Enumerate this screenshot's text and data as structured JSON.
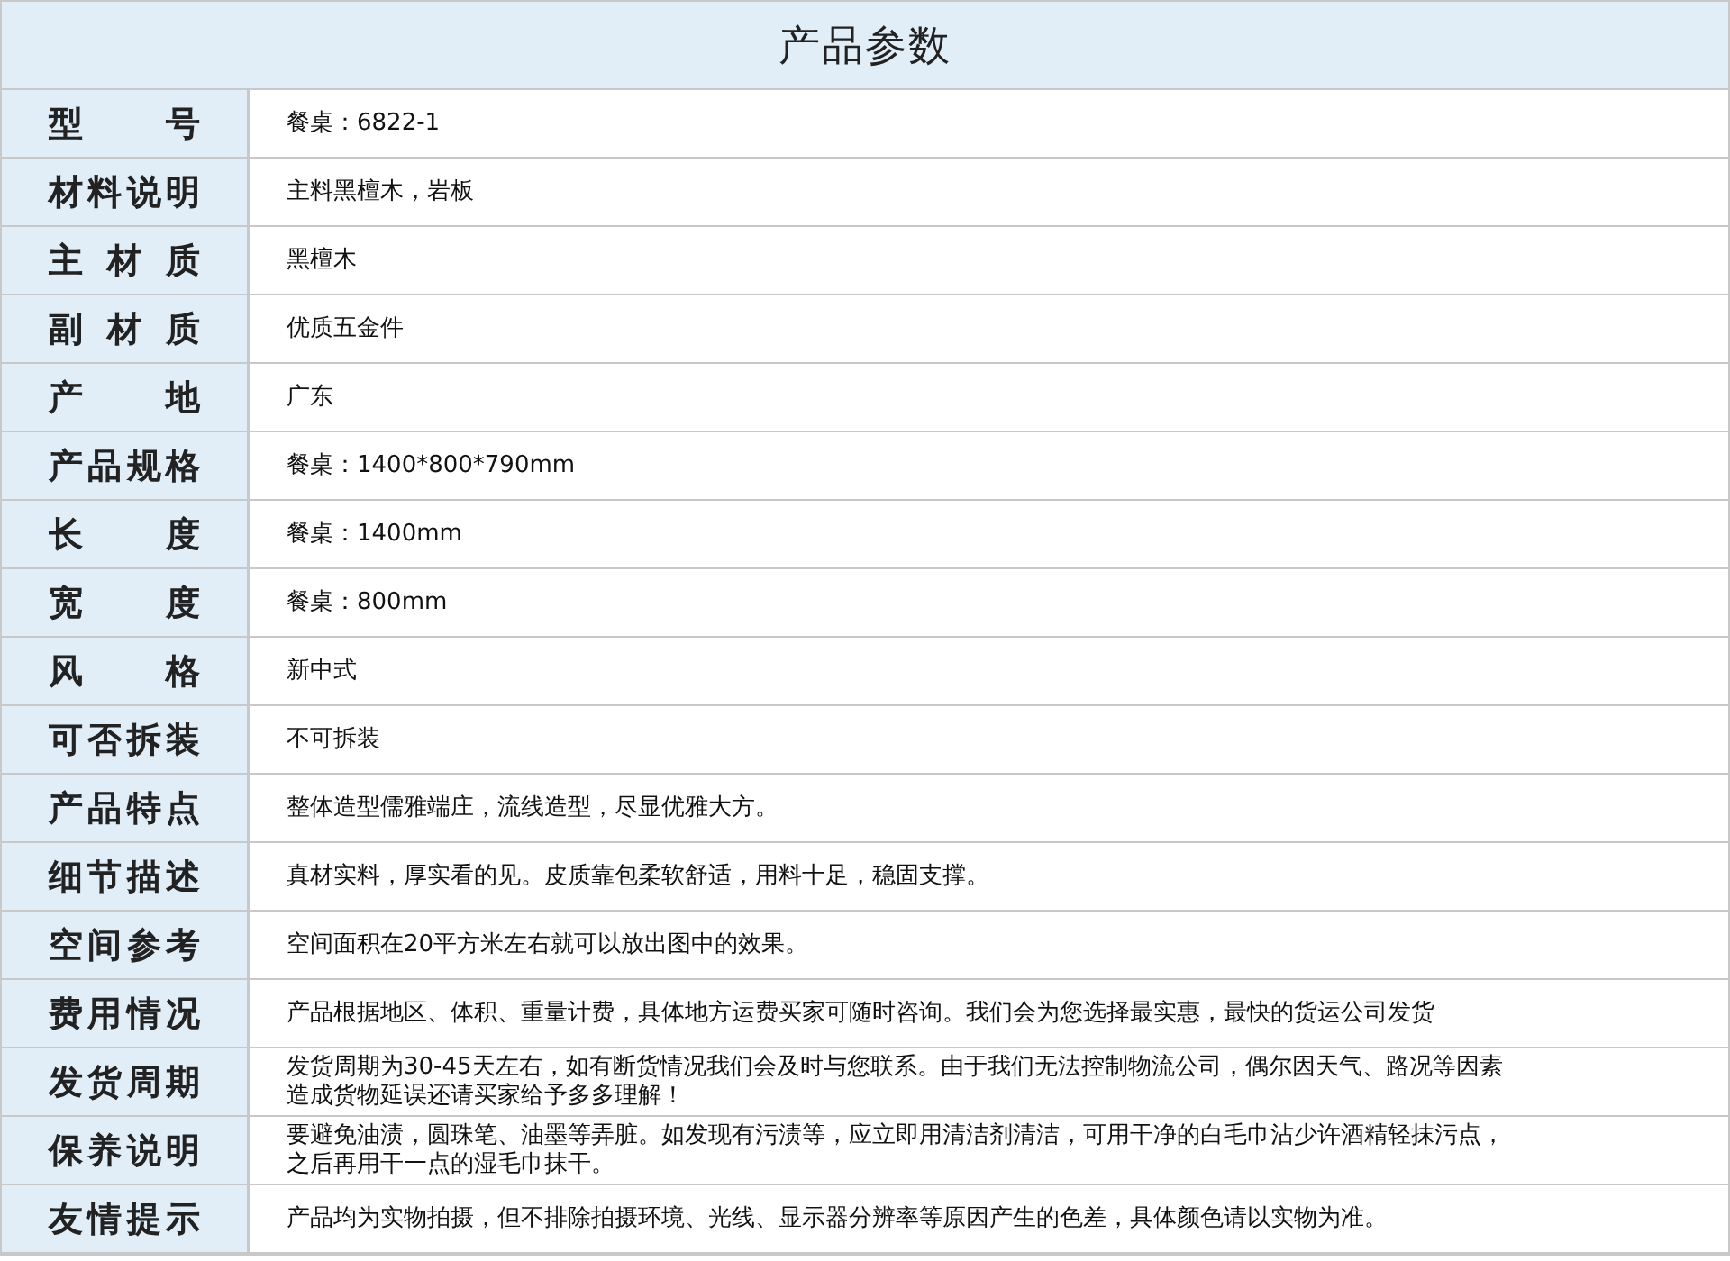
{
  "title": "产品参数",
  "rows": [
    {
      "label": "型 号",
      "value": [
        "餐桌：6822-1"
      ]
    },
    {
      "label": "材料说明",
      "value": [
        "主料黑檀木，岩板"
      ]
    },
    {
      "label": "主 材 质",
      "value": [
        "黑檀木"
      ]
    },
    {
      "label": "副 材 质",
      "value": [
        "优质五金件"
      ]
    },
    {
      "label": "产 地",
      "value": [
        "广东"
      ]
    },
    {
      "label": "产品规格",
      "value": [
        "餐桌：1400*800*790mm"
      ]
    },
    {
      "label": "长 度",
      "value": [
        "餐桌：1400mm"
      ]
    },
    {
      "label": "宽 度",
      "value": [
        "餐桌：800mm"
      ]
    },
    {
      "label": "风 格",
      "value": [
        "新中式"
      ]
    },
    {
      "label": "可否拆装",
      "value": [
        "不可拆装"
      ]
    },
    {
      "label": "产品特点",
      "value": [
        "整体造型儒雅端庄，流线造型，尽显优雅大方。"
      ]
    },
    {
      "label": "细节描述",
      "value": [
        "真材实料，厚实看的见。皮质靠包柔软舒适，用料十足，稳固支撑。"
      ]
    },
    {
      "label": "空间参考",
      "value": [
        "空间面积在20平方米左右就可以放出图中的效果。"
      ]
    },
    {
      "label": "费用情况",
      "value": [
        "产品根据地区、体积、重量计费，具体地方运费买家可随时咨询。我们会为您选择最实惠，最快的货运公司发货"
      ]
    },
    {
      "label": "发货周期",
      "value": [
        "发货周期为30-45天左右，如有断货情况我们会及时与您联系。由于我们无法控制物流公司，偶尔因天气、路况等因素",
        "造成货物延误还请买家给予多多理解！"
      ]
    },
    {
      "label": "保养说明",
      "value": [
        "要避免油渍，圆珠笔、油墨等弄脏。如发现有污渍等，应立即用清洁剂清洁，可用干净的白毛巾沾少许酒精轻抹污点，",
        "之后再用干一点的湿毛巾抹干。"
      ]
    },
    {
      "label": "友情提示",
      "value": [
        "产品均为实物拍摄，但不排除拍摄环境、光线、显示器分辨率等原因产生的色差，具体颜色请以实物为准。"
      ]
    }
  ]
}
